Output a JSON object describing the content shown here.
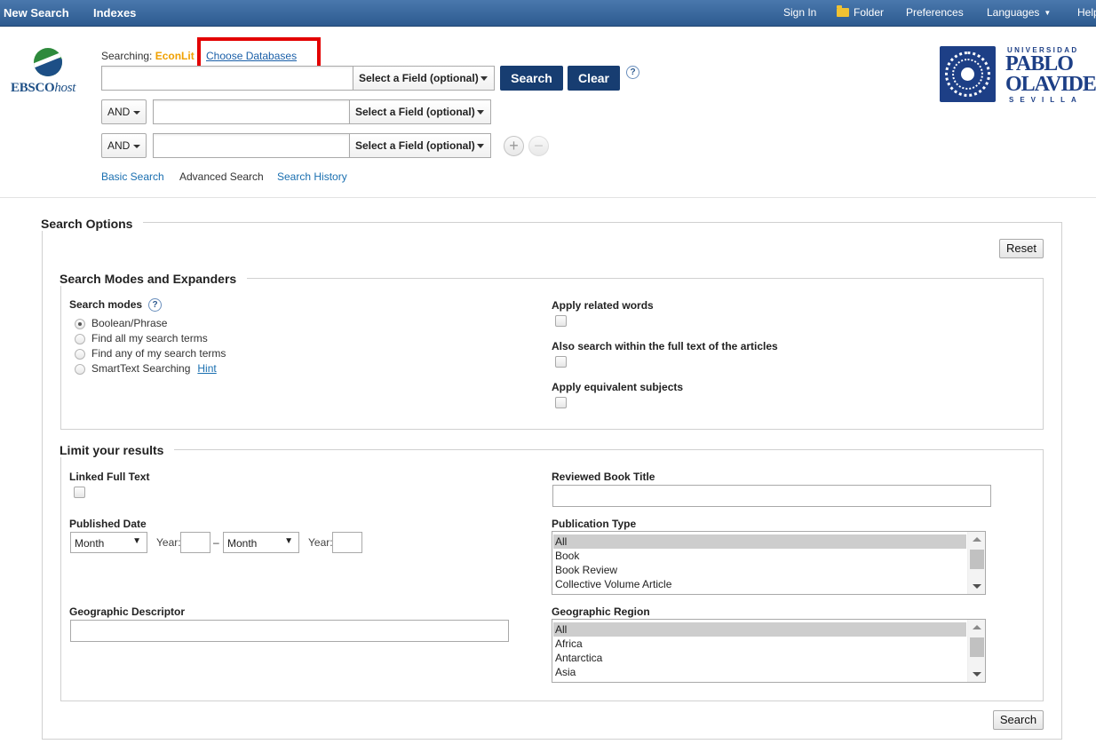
{
  "topnav": {
    "left": [
      "New Search",
      "Indexes"
    ],
    "sign_in": "Sign In",
    "folder": "Folder",
    "preferences": "Preferences",
    "languages": "Languages",
    "help": "Help"
  },
  "logo": {
    "brand_main": "EBSCO",
    "brand_host": "host"
  },
  "searching": {
    "label": "Searching:",
    "database": "EconLit",
    "choose_databases": "Choose Databases"
  },
  "search_rows": [
    {
      "bool": "",
      "value": "",
      "field": "Select a Field (optional)"
    },
    {
      "bool": "AND",
      "value": "",
      "field": "Select a Field (optional)"
    },
    {
      "bool": "AND",
      "value": "",
      "field": "Select a Field (optional)"
    }
  ],
  "buttons": {
    "search": "Search",
    "clear": "Clear",
    "help": "?",
    "add_row": "+",
    "remove_row": "−"
  },
  "sublinks": {
    "basic": "Basic Search",
    "advanced": "Advanced Search",
    "history": "Search History"
  },
  "university": {
    "top": "UNIVERSIDAD",
    "name_line1": "PABLO",
    "name_line2": "OLAVIDE",
    "city": "SEVILLA"
  },
  "options": {
    "title": "Search Options",
    "reset": "Reset",
    "modes_section": "Search Modes and Expanders",
    "modes_label": "Search modes",
    "modes": [
      {
        "label": "Boolean/Phrase",
        "checked": true
      },
      {
        "label": "Find all my search terms",
        "checked": false
      },
      {
        "label": "Find any of my search terms",
        "checked": false
      },
      {
        "label": "SmartText Searching",
        "checked": false
      }
    ],
    "hint": "Hint",
    "expanders": [
      "Apply related words",
      "Also search within the full text of the articles",
      "Apply equivalent subjects"
    ],
    "limits_section": "Limit your results",
    "linked_full_text": "Linked Full Text",
    "published_date": "Published Date",
    "month_placeholder": "Month",
    "year_label": "Year:",
    "date_dash": "–",
    "geographic_descriptor": "Geographic Descriptor",
    "reviewed_book_title": "Reviewed Book Title",
    "publication_type": {
      "label": "Publication Type",
      "options": [
        "All",
        "Book",
        "Book Review",
        "Collective Volume Article"
      ]
    },
    "geographic_region": {
      "label": "Geographic Region",
      "options": [
        "All",
        "Africa",
        "Antarctica",
        "Asia"
      ]
    },
    "search_bottom": "Search"
  },
  "colors": {
    "topbar": "#3b6aa0",
    "primary_button": "#173d71",
    "highlight_box": "#e30000",
    "db_name": "#f0a000",
    "link": "#1a6fb0"
  }
}
